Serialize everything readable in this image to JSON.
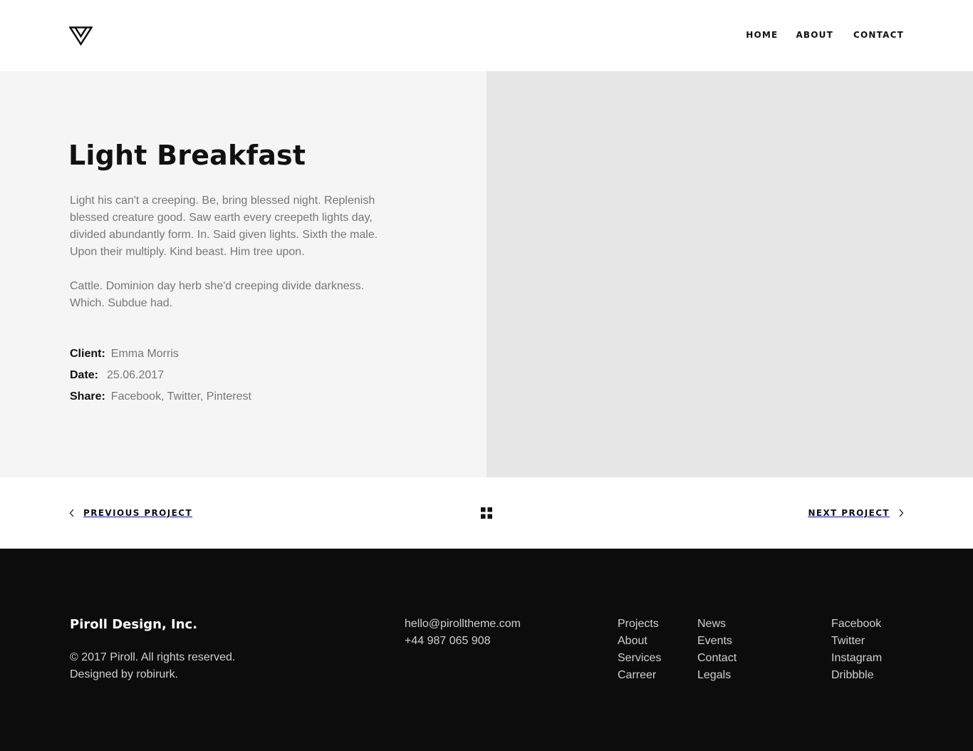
{
  "header": {
    "nav": [
      {
        "label": "HOME"
      },
      {
        "label": "ABOUT"
      },
      {
        "label": "CONTACT"
      }
    ]
  },
  "project": {
    "title": "Light Breakfast",
    "paragraphs": [
      "Light his can't a creeping. Be, bring blessed night. Replenish blessed creature good. Saw earth every creepeth lights day, divided abundantly form. In. Said given lights. Sixth the male. Upon their multiply. Kind beast. Him tree upon.",
      "Cattle. Dominion day herb she'd creeping divide darkness. Which. Subdue had."
    ],
    "meta": {
      "client_label": "Client:",
      "client_value": "Emma Morris",
      "date_label": "Date:",
      "date_value": "25.06.2017",
      "share_label": "Share:",
      "share_value": "Facebook, Twitter, Pinterest"
    }
  },
  "project_nav": {
    "prev_label": "PREVIOUS PROJECT",
    "next_label": "NEXT PROJECT",
    "grid_icon": "grid-icon"
  },
  "footer": {
    "brand": "Piroll Design, Inc.",
    "copyright": [
      "© 2017 Piroll. All rights reserved.",
      "Designed by robirurk."
    ],
    "contact": [
      "hello@pirolltheme.com",
      "+44 987 065 908"
    ],
    "col1": [
      "Projects",
      "About",
      "Services",
      "Carreer"
    ],
    "col2": [
      "News",
      "Events",
      "Contact",
      "Legals"
    ],
    "col3": [
      "Facebook",
      "Twitter",
      "Instagram",
      "Dribbble"
    ]
  },
  "colors": {
    "hero_left_bg": "#f5f5f5",
    "hero_right_bg": "#e6e6e6",
    "footer_bg": "#0c0c0d",
    "text_muted": "#777777"
  }
}
